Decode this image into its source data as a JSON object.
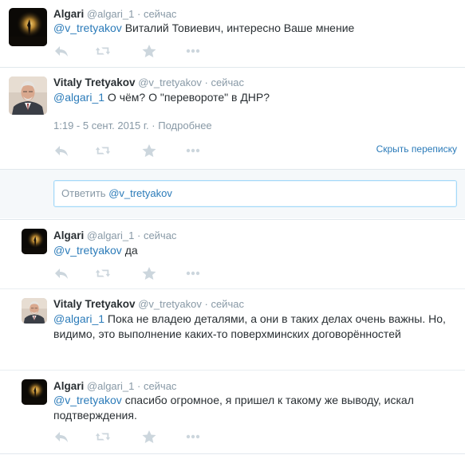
{
  "tweets": [
    {
      "fullname": "Algari",
      "screen_name": "@algari_1",
      "separator": "·",
      "time": "сейчас",
      "mention": "@v_tretyakov",
      "text": " Виталий Товиевич,  интересно Ваше мнение",
      "avatar": "algari-avatar"
    },
    {
      "fullname": "Vitaly Tretyakov",
      "screen_name": "@v_tretyakov",
      "separator": "·",
      "time": "сейчас",
      "mention": "@algari_1",
      "text": " О чём? О \"перевороте\" в ДНР?",
      "datetime": "1:19 - 5 сент. 2015 г.",
      "details_sep": "·",
      "details_link": "Подробнее",
      "hide_conversation": "Скрыть переписку",
      "avatar": "tretyakov-avatar"
    }
  ],
  "reply_box": {
    "prefix": "Ответить ",
    "mention": "@v_tretyakov"
  },
  "replies": [
    {
      "fullname": "Algari",
      "screen_name": "@algari_1",
      "separator": "·",
      "time": "сейчас",
      "mention": "@v_tretyakov",
      "text": " да"
    },
    {
      "fullname": "Vitaly Tretyakov",
      "screen_name": "@v_tretyakov",
      "separator": "·",
      "time": "сейчас",
      "mention": "@algari_1",
      "text_line1": " Пока не владею деталями, а они в таких делах очень важны. Но,",
      "text_line2": "видимо, это выполнение каких-то поверхминских договорённостей"
    },
    {
      "fullname": "Algari",
      "screen_name": "@algari_1",
      "separator": "·",
      "time": "сейчас",
      "mention": "@v_tretyakov",
      "text_line1": " спасибо огромное, я пришел к такому же выводу, искал",
      "text_line2": "подтверждения."
    }
  ],
  "icons": [
    "reply-icon",
    "retweet-icon",
    "favorite-icon",
    "more-icon"
  ],
  "colors": {
    "link": "#2b7bb9",
    "muted": "#8899a6",
    "text": "#292f33",
    "icon": "#ccd6dd",
    "divider": "#e1e8ed"
  }
}
